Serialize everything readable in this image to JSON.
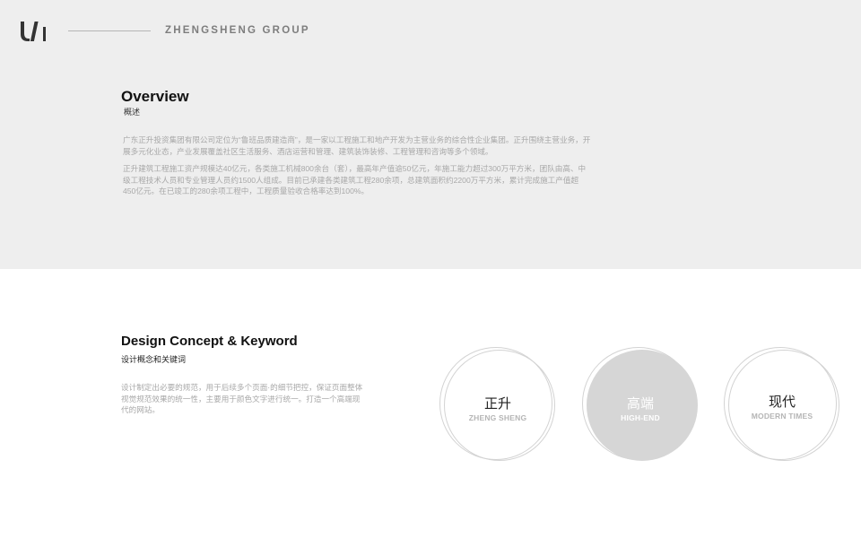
{
  "header": {
    "logo_icon": "brand-logo-icon",
    "brand": "ZHENGSHENG GROUP"
  },
  "overview": {
    "title": "Overview",
    "subtitle": "概述",
    "paragraph1": "广东正升投资集团有限公司定位为“鲁班品质建造商”，是一家以工程施工和地产开发为主营业务的综合性企业集团。正升围绕主营业务，开展多元化业态，产业发展覆盖社区生活服务、酒店运营和管理、建筑装饰装修、工程管理和咨询等多个领域。",
    "paragraph2": "正升建筑工程施工资产规模达40亿元，各类施工机械800余台（套），最高年产值逾50亿元，年施工能力超过300万平方米，团队由高、中级工程技术人员和专业管理人员约1500人组成。目前已承建各类建筑工程280余项，总建筑面积约2200万平方米，累计完成施工产值超450亿元。在已竣工的280余项工程中，工程质量验收合格率达到100%。"
  },
  "design": {
    "title": "Design Concept & Keyword",
    "subtitle": "设计概念和关键词",
    "paragraph": "设计制定出必要的规范，用于后续多个页面·的细节把控，保证页面整体视觉规范效果的统一性，主要用于颜色文字进行统一。打造一个高端现代的网站。",
    "keywords": [
      {
        "zh": "正升",
        "en": "ZHENG SHENG"
      },
      {
        "zh": "高端",
        "en": "HIGH-END"
      },
      {
        "zh": "现代",
        "en": "MODERN TIMES"
      }
    ]
  },
  "colors": {
    "top_background": "#eeeeee",
    "circle_fill": "#d6d6d6",
    "circle_stroke": "#d3d3d3",
    "muted_text": "#a8a8a8"
  }
}
